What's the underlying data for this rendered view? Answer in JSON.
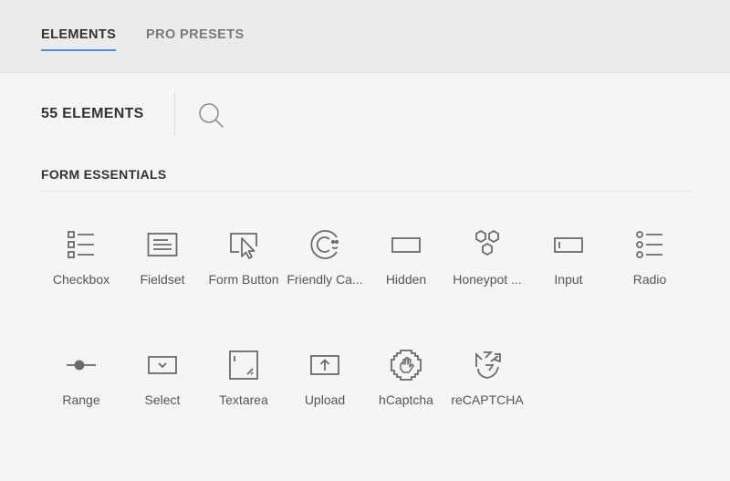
{
  "tabs": {
    "elements": "ELEMENTS",
    "pro_presets": "PRO PRESETS"
  },
  "header": {
    "count": "55 ELEMENTS"
  },
  "section": {
    "title": "FORM ESSENTIALS"
  },
  "elements": [
    {
      "label": "Checkbox",
      "icon": "checkbox-icon"
    },
    {
      "label": "Fieldset",
      "icon": "fieldset-icon"
    },
    {
      "label": "Form Button",
      "icon": "form-button-icon"
    },
    {
      "label": "Friendly Ca...",
      "icon": "friendly-captcha-icon"
    },
    {
      "label": "Hidden",
      "icon": "hidden-icon"
    },
    {
      "label": "Honeypot ...",
      "icon": "honeypot-icon"
    },
    {
      "label": "Input",
      "icon": "input-icon"
    },
    {
      "label": "Radio",
      "icon": "radio-icon"
    },
    {
      "label": "Range",
      "icon": "range-icon"
    },
    {
      "label": "Select",
      "icon": "select-icon"
    },
    {
      "label": "Textarea",
      "icon": "textarea-icon"
    },
    {
      "label": "Upload",
      "icon": "upload-icon"
    },
    {
      "label": "hCaptcha",
      "icon": "hcaptcha-icon"
    },
    {
      "label": "reCAPTCHA",
      "icon": "recaptcha-icon"
    }
  ],
  "colors": {
    "accent": "#4a90d9",
    "icon": "#6b6b6b"
  }
}
